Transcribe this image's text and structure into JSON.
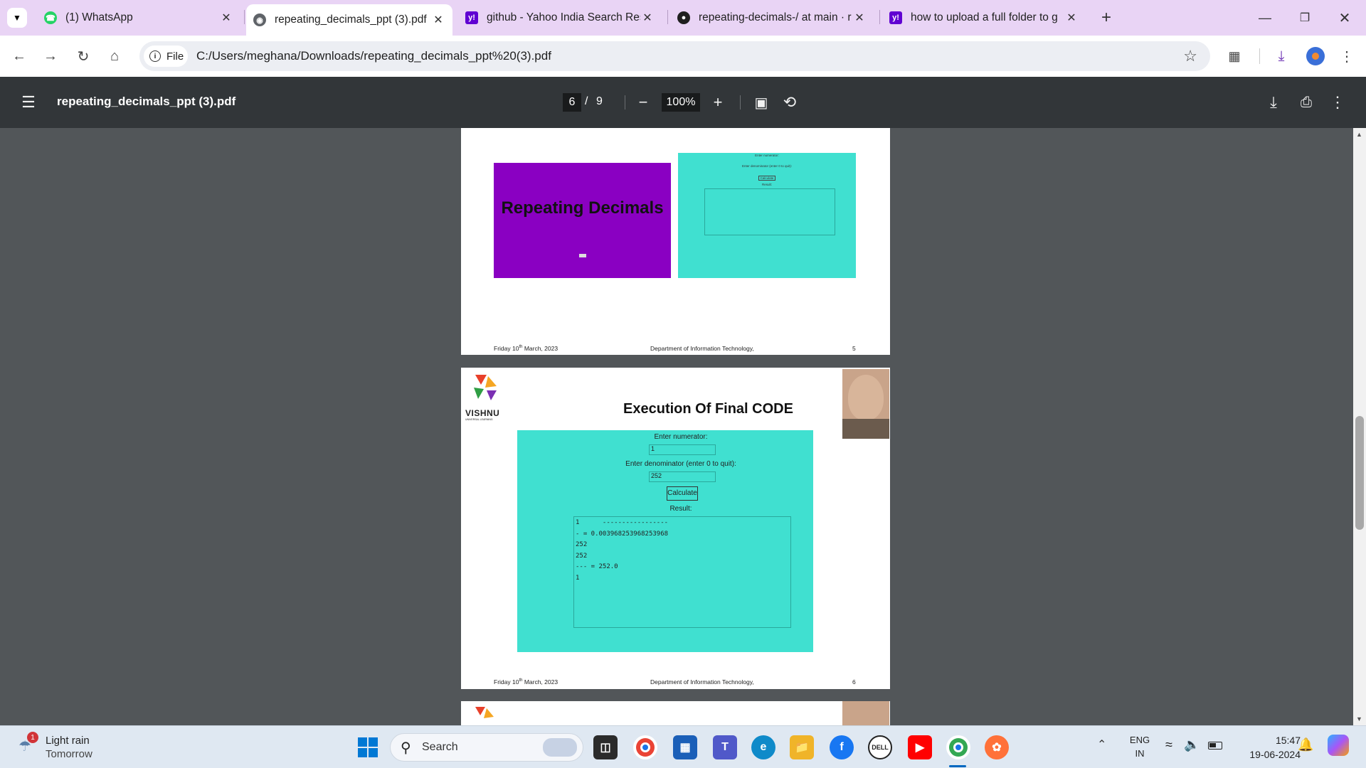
{
  "browser": {
    "tabs": [
      {
        "title": "(1) WhatsApp",
        "icon": "whatsapp-icon",
        "active": false
      },
      {
        "title": "repeating_decimals_ppt (3).pdf",
        "icon": "globe-icon",
        "active": true
      },
      {
        "title": "github - Yahoo India Search Res",
        "icon": "yahoo-icon",
        "active": false
      },
      {
        "title": "repeating-decimals-/ at main · r",
        "icon": "github-icon",
        "active": false
      },
      {
        "title": "how to upload a full folder to g",
        "icon": "yahoo-icon",
        "active": false
      }
    ],
    "omnibox": {
      "chip": "File",
      "url": "C:/Users/meghana/Downloads/repeating_decimals_ppt%20(3).pdf"
    }
  },
  "pdf": {
    "title": "repeating_decimals_ppt (3).pdf",
    "current_page": "6",
    "page_sep": "/",
    "total_pages": "9",
    "zoom": "100%"
  },
  "page5": {
    "slide_title": "Repeating Decimals",
    "mini_form": {
      "numerator_label": "Enter numerator:",
      "denominator_label": "Enter denominator (enter 0 to quit):",
      "button": "Calculate",
      "result_label": "Result:"
    },
    "footer": {
      "date_pre": "Friday 10",
      "date_sup": "th",
      "date_post": " March, 2023",
      "dept": "Department of Information Technology,",
      "num": "5"
    }
  },
  "page6": {
    "logo_text": "VISHNU",
    "logo_sub": "UNIVERSAL LEARNING",
    "heading": "Execution Of Final CODE",
    "form": {
      "numerator_label": "Enter numerator:",
      "numerator_value": "1",
      "denominator_label": "Enter denominator (enter 0 to quit):",
      "denominator_value": "252",
      "button": "Calculate",
      "result_label": "Result:",
      "result_lines": [
        "1      -----------------",
        "- = 0.003968253968253968",
        "252",
        "252",
        "--- = 252.0",
        "1"
      ]
    },
    "footer": {
      "date_pre": "Friday 10",
      "date_sup": "th",
      "date_post": " March, 2023",
      "dept": "Department of Information Technology,",
      "num": "6"
    }
  },
  "taskbar": {
    "weather": {
      "title": "Light rain",
      "sub": "Tomorrow",
      "badge": "1"
    },
    "search_placeholder": "Search",
    "lang_top": "ENG",
    "lang_bottom": "IN",
    "time": "15:47",
    "date": "19-06-2024"
  },
  "colors": {
    "tabstrip": "#e9d4f5",
    "pdf_toolbar": "#323639",
    "viewer_bg": "#525659",
    "slide_purple": "#8a00c2",
    "turquoise": "#40e0d0"
  }
}
